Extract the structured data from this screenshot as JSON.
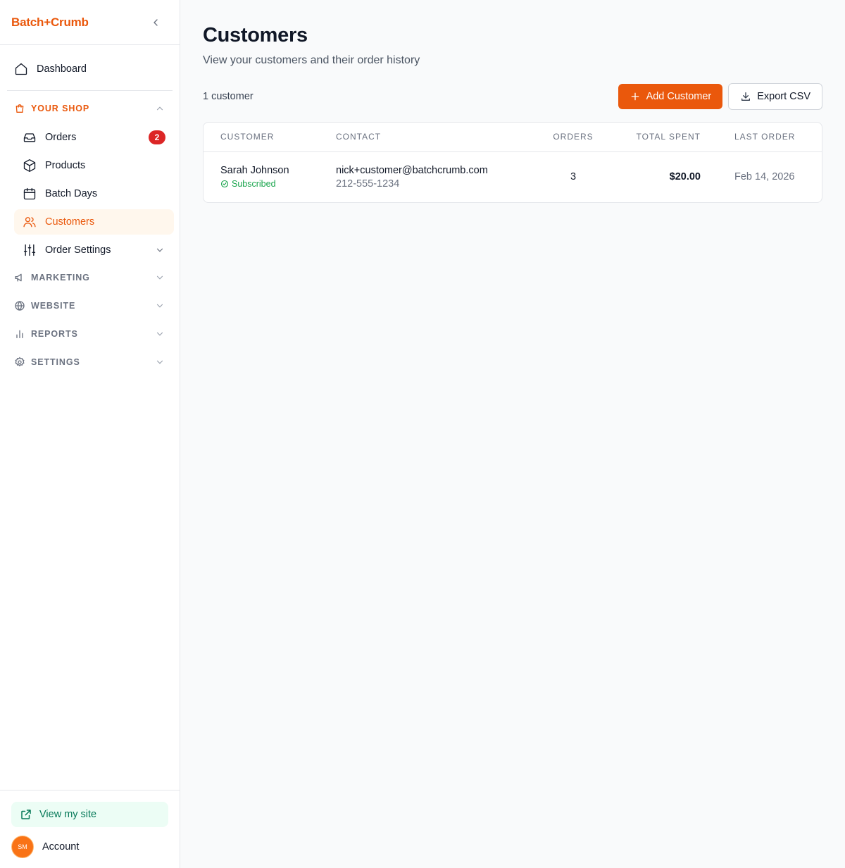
{
  "brand": {
    "name": "Batch+Crumb",
    "color": "#ea580c"
  },
  "sidebar": {
    "dashboard": "Dashboard",
    "your_shop": {
      "label": "YOUR SHOP",
      "items": [
        {
          "label": "Orders",
          "badge": "2"
        },
        {
          "label": "Products"
        },
        {
          "label": "Batch Days"
        },
        {
          "label": "Customers"
        },
        {
          "label": "Order Settings"
        }
      ]
    },
    "sections": [
      {
        "label": "MARKETING",
        "icon": "megaphone-icon"
      },
      {
        "label": "WEBSITE",
        "icon": "globe-icon"
      },
      {
        "label": "REPORTS",
        "icon": "bar-chart-icon"
      },
      {
        "label": "SETTINGS",
        "icon": "gear-icon"
      }
    ],
    "view_site": "View my site",
    "account": {
      "label": "Account",
      "avatar_initials": "SM"
    }
  },
  "page": {
    "title": "Customers",
    "subtitle": "View your customers and their order history",
    "count": "1 customer",
    "add_button": "Add Customer",
    "export_button": "Export CSV"
  },
  "table": {
    "headers": [
      "CUSTOMER",
      "CONTACT",
      "ORDERS",
      "TOTAL SPENT",
      "LAST ORDER"
    ],
    "rows": [
      {
        "name": "Sarah Johnson",
        "status": "Subscribed",
        "email": "nick+customer@batchcrumb.com",
        "phone": "212-555-1234",
        "orders": "3",
        "total": "$20.00",
        "last_order": "Feb 14, 2026"
      }
    ]
  },
  "colors": {
    "accent": "#ea580c",
    "badge": "#dc2626",
    "success": "#16a34a",
    "active_bg": "#fff7ed",
    "site_bg": "#ecfdf5"
  }
}
